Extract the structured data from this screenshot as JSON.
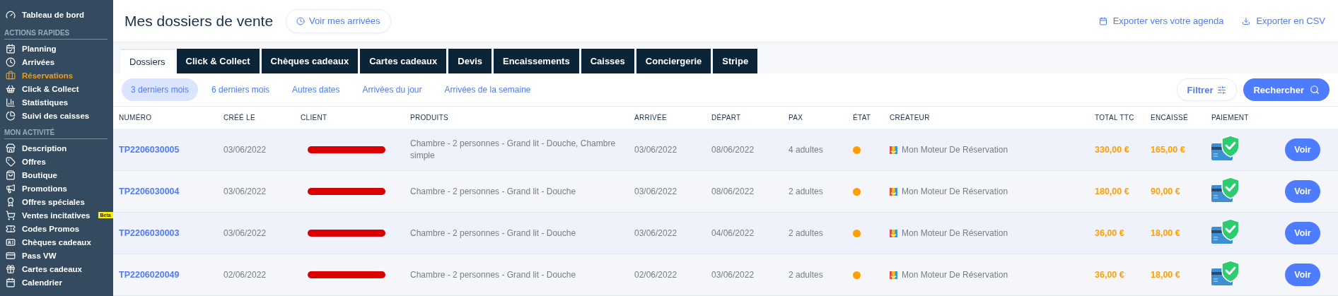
{
  "sidebar": {
    "top": {
      "label": "Tableau de bord"
    },
    "sections": [
      {
        "title": "ACTIONS RAPIDES",
        "items": [
          {
            "label": "Planning",
            "selected": false
          },
          {
            "label": "Arrivées",
            "selected": false
          },
          {
            "label": "Réservations",
            "selected": true
          },
          {
            "label": "Click & Collect",
            "selected": false
          },
          {
            "label": "Statistiques",
            "selected": false
          },
          {
            "label": "Suivi des caisses",
            "selected": false
          }
        ]
      },
      {
        "title": "MON ACTIVITÉ",
        "items": [
          {
            "label": "Description",
            "selected": false
          },
          {
            "label": "Offres",
            "selected": false
          },
          {
            "label": "Boutique",
            "selected": false
          },
          {
            "label": "Promotions",
            "selected": false
          },
          {
            "label": "Offres spéciales",
            "selected": false
          },
          {
            "label": "Ventes incitatives",
            "selected": false,
            "badge": "Beta"
          },
          {
            "label": "Codes Promos",
            "selected": false
          },
          {
            "label": "Chèques cadeaux",
            "selected": false
          },
          {
            "label": "Pass VW",
            "selected": false
          },
          {
            "label": "Cartes cadeaux",
            "selected": false
          },
          {
            "label": "Calendrier",
            "selected": false
          }
        ]
      }
    ]
  },
  "header": {
    "title": "Mes dossiers de vente",
    "arrivals_button": "Voir mes arrivées",
    "actions": [
      "Exporter vers votre agenda",
      "Exporter en CSV"
    ]
  },
  "tabs": [
    {
      "label": "Dossiers",
      "selected": true
    },
    {
      "label": "Click & Collect",
      "selected": false
    },
    {
      "label": "Chèques cadeaux",
      "selected": false
    },
    {
      "label": "Cartes cadeaux",
      "selected": false
    },
    {
      "label": "Devis",
      "selected": false
    },
    {
      "label": "Encaissements",
      "selected": false
    },
    {
      "label": "Caisses",
      "selected": false
    },
    {
      "label": "Conciergerie",
      "selected": false
    },
    {
      "label": "Stripe",
      "selected": false
    }
  ],
  "periods": [
    {
      "label": "3 derniers mois",
      "selected": true
    },
    {
      "label": "6 derniers mois",
      "selected": false
    },
    {
      "label": "Autres dates",
      "selected": false
    },
    {
      "label": "Arrivées du jour",
      "selected": false
    },
    {
      "label": "Arrivées de la semaine",
      "selected": false
    }
  ],
  "filter_button": "Filtrer",
  "search_button": "Rechercher",
  "table": {
    "columns": [
      "NUMÉRO",
      "CRÉÉ LE",
      "CLIENT",
      "PRODUITS",
      "ARRIVÉE",
      "DÉPART",
      "PAX",
      "ÉTAT",
      "CRÉATEUR",
      "TOTAL TTC",
      "ENCAISSÉ",
      "PAIEMENT"
    ],
    "rows": [
      {
        "number": "TP2206030005",
        "created": "03/06/2022",
        "client_redacted": true,
        "products": "Chambre - 2 personnes - Grand lit - Douche, Chambre simple",
        "arrival": "03/06/2022",
        "departure": "08/06/2022",
        "pax": "4 adultes",
        "color": "#ff9f00",
        "creator": "Mon Moteur De Réservation",
        "total": "330,00 €",
        "collected": "165,00 €",
        "paid": true,
        "action": "Voir"
      },
      {
        "number": "TP2206030004",
        "created": "03/06/2022",
        "client_redacted": true,
        "products": "Chambre - 2 personnes - Grand lit - Douche",
        "arrival": "03/06/2022",
        "departure": "08/06/2022",
        "pax": "2 adultes",
        "color": "#ff9f00",
        "creator": "Mon Moteur De Réservation",
        "total": "180,00 €",
        "collected": "90,00 €",
        "paid": true,
        "action": "Voir"
      },
      {
        "number": "TP2206030003",
        "created": "03/06/2022",
        "client_redacted": true,
        "products": "Chambre - 2 personnes - Grand lit - Douche",
        "arrival": "03/06/2022",
        "departure": "04/06/2022",
        "pax": "2 adultes",
        "color": "#ff9f00",
        "creator": "Mon Moteur De Réservation",
        "total": "36,00 €",
        "collected": "18,00 €",
        "paid": true,
        "action": "Voir"
      },
      {
        "number": "TP2206020049",
        "created": "02/06/2022",
        "client_redacted": true,
        "products": "Chambre - 2 personnes - Grand lit - Douche",
        "arrival": "02/06/2022",
        "departure": "03/06/2022",
        "pax": "2 adultes",
        "color": "#ff9f00",
        "creator": "Mon Moteur De Réservation",
        "total": "36,00 €",
        "collected": "18,00 €",
        "paid": true,
        "action": "Voir"
      }
    ]
  }
}
